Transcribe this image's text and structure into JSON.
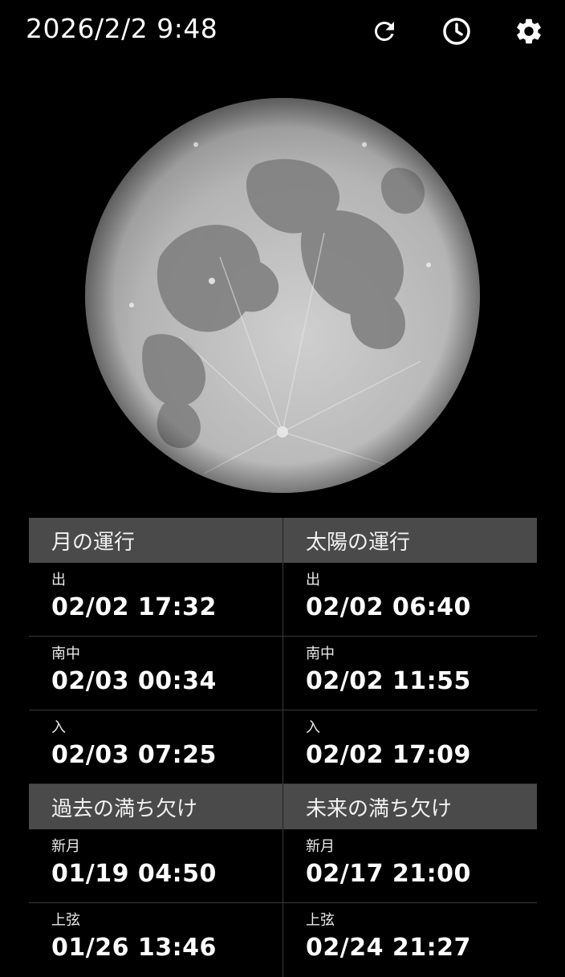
{
  "header": {
    "datetime": "2026/2/2 9:48",
    "icons": [
      "refresh-icon",
      "clock-icon",
      "gear-icon"
    ]
  },
  "moon": {
    "phase": "full-moon"
  },
  "sections": [
    {
      "left_title": "月の運行",
      "right_title": "太陽の運行",
      "rows": [
        {
          "left_label": "出",
          "left_value": "02/02 17:32",
          "right_label": "出",
          "right_value": "02/02 06:40"
        },
        {
          "left_label": "南中",
          "left_value": "02/03 00:34",
          "right_label": "南中",
          "right_value": "02/02 11:55"
        },
        {
          "left_label": "入",
          "left_value": "02/03 07:25",
          "right_label": "入",
          "right_value": "02/02 17:09"
        }
      ]
    },
    {
      "left_title": "過去の満ち欠け",
      "right_title": "未来の満ち欠け",
      "rows": [
        {
          "left_label": "新月",
          "left_value": "01/19 04:50",
          "right_label": "新月",
          "right_value": "02/17 21:00"
        },
        {
          "left_label": "上弦",
          "left_value": "01/26 13:46",
          "right_label": "上弦",
          "right_value": "02/24 21:27"
        }
      ]
    }
  ]
}
